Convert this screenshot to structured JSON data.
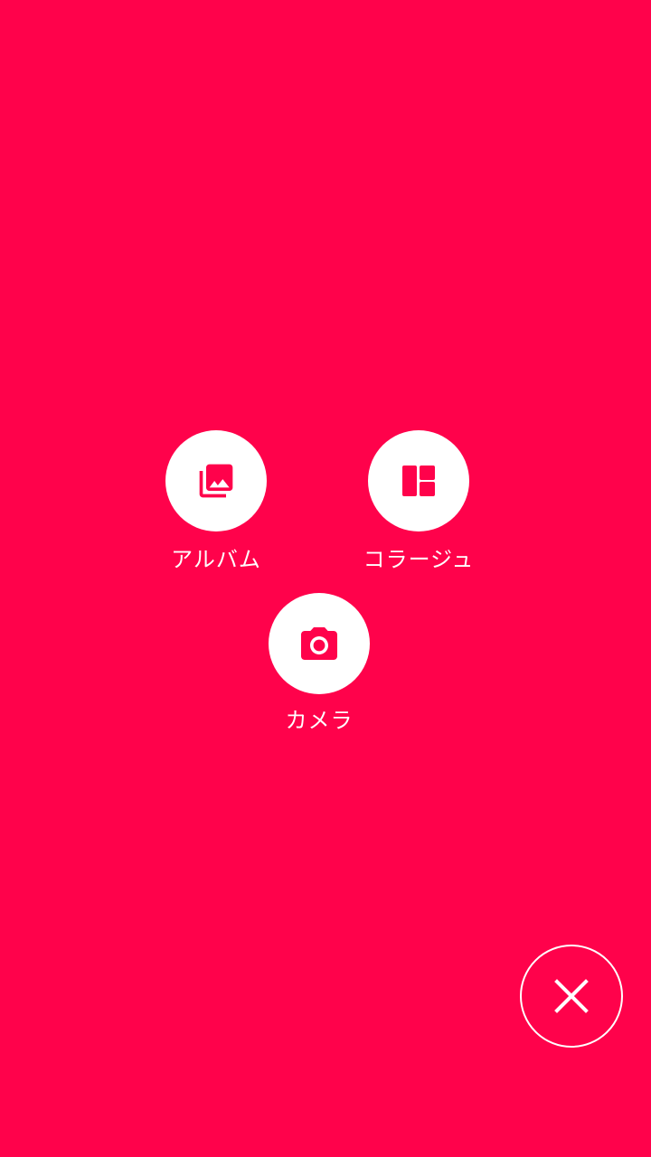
{
  "theme": {
    "background": "#FF024B",
    "icon_color": "#FF024B",
    "circle_color": "#FFFFFF",
    "text_color": "#FFFFFF"
  },
  "actions": [
    {
      "id": "album",
      "label": "アルバム",
      "icon": "photo-library-icon"
    },
    {
      "id": "collage",
      "label": "コラージュ",
      "icon": "collage-layout-icon"
    },
    {
      "id": "camera",
      "label": "カメラ",
      "icon": "camera-icon"
    }
  ],
  "close_button": {
    "icon": "close-icon"
  }
}
